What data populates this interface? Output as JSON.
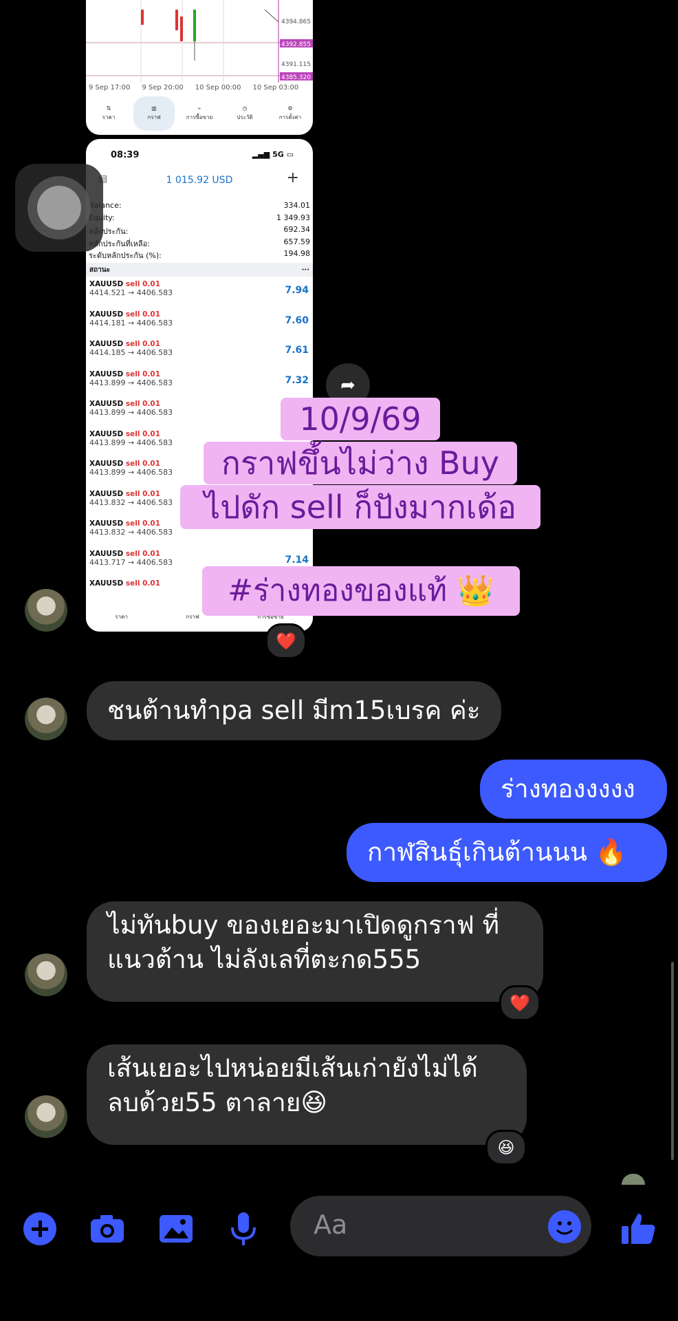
{
  "shot1": {
    "price_labels": [
      "4394.865",
      "4392.855",
      "4391.115",
      "4385.320"
    ],
    "x_labels": [
      "9 Sep 17:00",
      "9 Sep 20:00",
      "10 Sep 00:00",
      "10 Sep 03:00"
    ],
    "tabs": [
      {
        "label": "ราคา",
        "icon": "arrows-updown-icon"
      },
      {
        "label": "กราฟ",
        "icon": "candles-icon"
      },
      {
        "label": "การซื้อขาย",
        "icon": "trade-chart-icon"
      },
      {
        "label": "ประวัติ",
        "icon": "clock-icon"
      },
      {
        "label": "การตั้งค่า",
        "icon": "gear-icon"
      }
    ]
  },
  "shot2": {
    "status_time": "08:39",
    "status_network": "5G",
    "balance_title": "1 015.92 USD",
    "account": [
      {
        "label": "Balance:",
        "value": "334.01"
      },
      {
        "label": "Equity:",
        "value": "1 349.93"
      },
      {
        "label": "หลักประกัน:",
        "value": "692.34"
      },
      {
        "label": "หลักประกันที่เหลือ:",
        "value": "657.59"
      },
      {
        "label": "ระดับหลักประกัน (%):",
        "value": "194.98"
      }
    ],
    "status_label": "สถานะ",
    "status_more": "···",
    "trades": [
      {
        "symbol": "XAUUSD",
        "dir": "sell 0.01",
        "prices": "4414.521 → 4406.583",
        "pl": "7.94"
      },
      {
        "symbol": "XAUUSD",
        "dir": "sell 0.01",
        "prices": "4414.181 → 4406.583",
        "pl": "7.60"
      },
      {
        "symbol": "XAUUSD",
        "dir": "sell 0.01",
        "prices": "4414.185 → 4406.583",
        "pl": "7.61"
      },
      {
        "symbol": "XAUUSD",
        "dir": "sell 0.01",
        "prices": "4413.899 → 4406.583",
        "pl": "7.32"
      },
      {
        "symbol": "XAUUSD",
        "dir": "sell 0.01",
        "prices": "4413.899 → 4406.583",
        "pl": ""
      },
      {
        "symbol": "XAUUSD",
        "dir": "sell 0.01",
        "prices": "4413.899 → 4406.583",
        "pl": ""
      },
      {
        "symbol": "XAUUSD",
        "dir": "sell 0.01",
        "prices": "4413.899 → 4406.583",
        "pl": ""
      },
      {
        "symbol": "XAUUSD",
        "dir": "sell 0.01",
        "prices": "4413.832 → 4406.583",
        "pl": ""
      },
      {
        "symbol": "XAUUSD",
        "dir": "sell 0.01",
        "prices": "4413.832 → 4406.583",
        "pl": ""
      },
      {
        "symbol": "XAUUSD",
        "dir": "sell 0.01",
        "prices": "4413.717 → 4406.583",
        "pl": "7.14"
      },
      {
        "symbol": "XAUUSD",
        "dir": "sell 0.01",
        "prices": "",
        "pl": ""
      }
    ],
    "bottom_tabs": [
      "ราคา",
      "กราฟ",
      "การซื้อขาย"
    ]
  },
  "overlay": {
    "line1": "10/9/69",
    "line2": "กราฟขึ้นไม่ว่าง Buy",
    "line3": "ไปดัก sell ก็ปังมากเด้อ",
    "line4": "#ร่างทองของแท้ 👑"
  },
  "messages": [
    {
      "side": "in",
      "text": "ชนต้านทำpa sell มีm15เบรค ค่ะ"
    },
    {
      "side": "out",
      "text": "ร่างทองงงงง"
    },
    {
      "side": "out",
      "text": "กาฬสินธุ์เกินต้านนน 🔥"
    },
    {
      "side": "in",
      "line1": "ไม่ทันbuy ของเยอะมาเปิดดูกราฟ ที่",
      "line2": "แนวต้าน ไม่ลังเลที่ตะกด555",
      "reaction": "❤️"
    },
    {
      "side": "in",
      "line1": "เส้นเยอะไปหน่อยมีเส้นเก่ายังไม่ได้",
      "line2": "ลบด้วย55 ตาลาย😆",
      "reaction": "😆"
    }
  ],
  "image_reaction": "❤️",
  "composer": {
    "placeholder": "Aa",
    "icons": [
      "plus-icon",
      "camera-icon",
      "gallery-icon",
      "microphone-icon",
      "emoji-icon",
      "thumbs-up-icon"
    ]
  },
  "colors": {
    "accent": "#3d5afe",
    "incoming_bubble": "#303030",
    "overlay_bg": "#f0b4f3",
    "overlay_text": "#6a1b9a"
  }
}
